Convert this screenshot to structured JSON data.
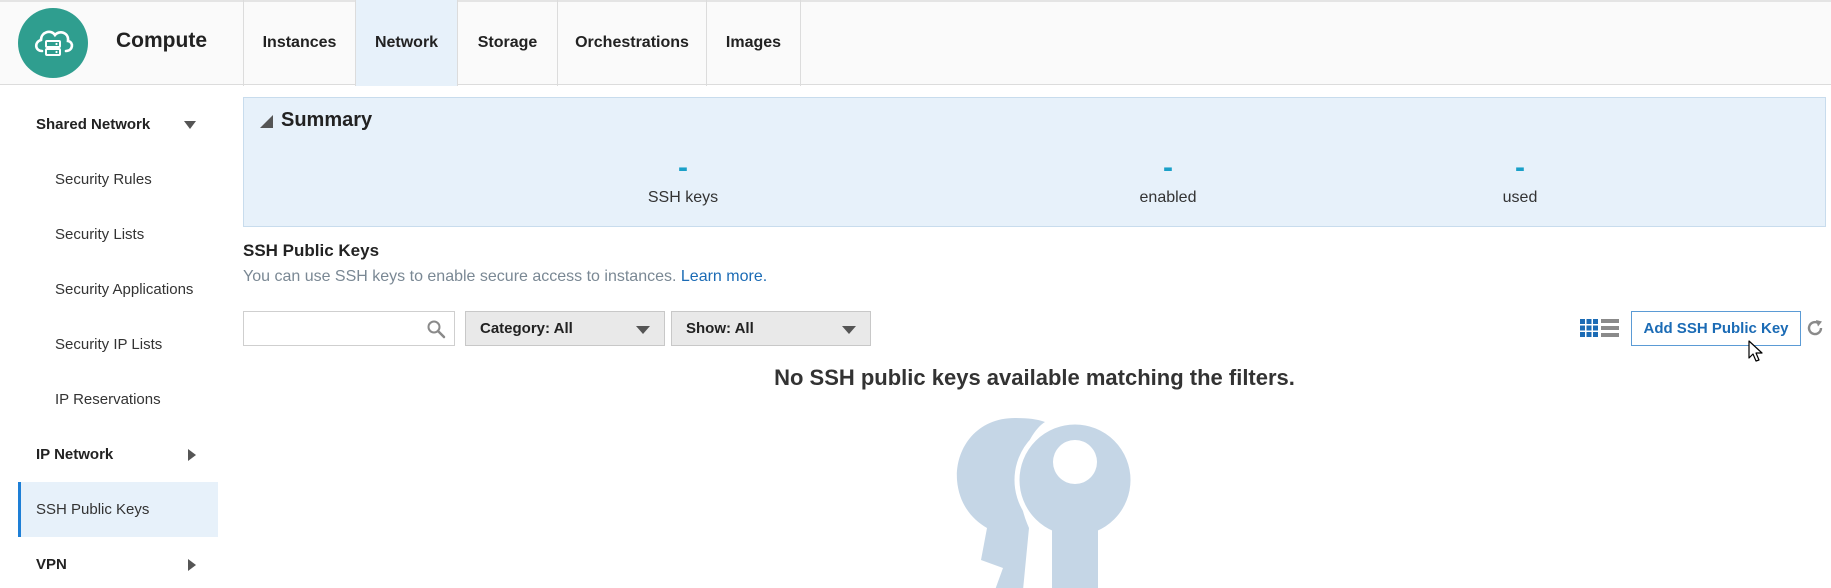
{
  "app": {
    "title": "Compute"
  },
  "tabs": [
    {
      "label": "Instances",
      "active": false
    },
    {
      "label": "Network",
      "active": true
    },
    {
      "label": "Storage",
      "active": false
    },
    {
      "label": "Orchestrations",
      "active": false
    },
    {
      "label": "Images",
      "active": false
    }
  ],
  "sidebar": {
    "items": [
      {
        "label": "Shared Network",
        "type": "group",
        "caret": "down"
      },
      {
        "label": "Security Rules",
        "type": "sub"
      },
      {
        "label": "Security Lists",
        "type": "sub"
      },
      {
        "label": "Security Applications",
        "type": "sub"
      },
      {
        "label": "Security IP Lists",
        "type": "sub"
      },
      {
        "label": "IP Reservations",
        "type": "sub"
      },
      {
        "label": "IP Network",
        "type": "group",
        "caret": "right"
      },
      {
        "label": "SSH Public Keys",
        "type": "group-active"
      },
      {
        "label": "VPN",
        "type": "group",
        "caret": "right"
      }
    ]
  },
  "summary": {
    "title": "Summary",
    "stats": [
      {
        "value": "-",
        "label": "SSH keys"
      },
      {
        "value": "-",
        "label": "enabled"
      },
      {
        "value": "-",
        "label": "used"
      }
    ]
  },
  "section": {
    "title": "SSH Public Keys",
    "description": "You can use SSH keys to enable secure access to instances.",
    "learn_more": "Learn more."
  },
  "filters": {
    "search_placeholder": "",
    "category": "Category: All",
    "show": "Show: All"
  },
  "toolbar": {
    "add_label": "Add SSH Public Key"
  },
  "empty_state": {
    "message": "No SSH public keys available matching the filters."
  },
  "colors": {
    "accent": "#1b6bb5",
    "logo": "#2f9e8f",
    "stat_value": "#1aa0c8",
    "active_bg": "#e7f1fa",
    "illustration": "#c5d6e6"
  },
  "icons": {
    "logo": "cloud-server-icon",
    "search": "search-icon",
    "view_toggle": "grid-list-icon",
    "refresh": "refresh-icon",
    "empty": "keys-icon"
  }
}
